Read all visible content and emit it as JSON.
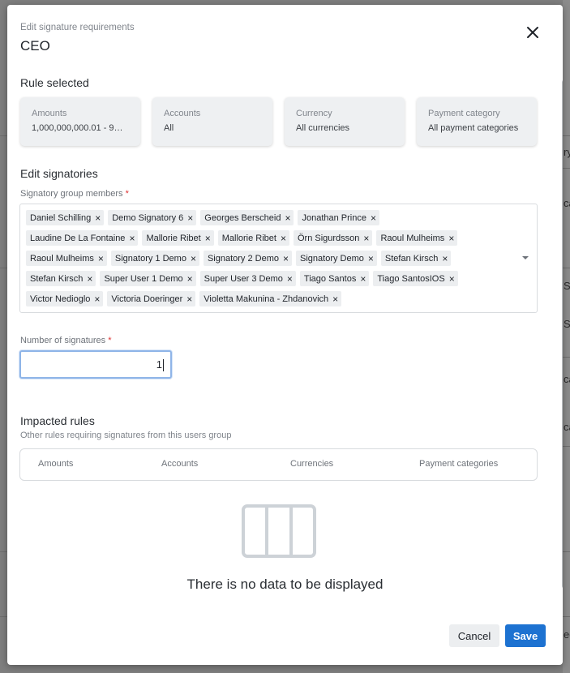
{
  "modal": {
    "caption": "Edit signature requirements",
    "title": "CEO"
  },
  "rule_selected": {
    "title": "Rule selected",
    "cards": [
      {
        "label": "Amounts",
        "value": "1,000,000,000.01 - 9…"
      },
      {
        "label": "Accounts",
        "value": "All"
      },
      {
        "label": "Currency",
        "value": "All currencies"
      },
      {
        "label": "Payment category",
        "value": "All payment categories"
      }
    ]
  },
  "edit_signatories": {
    "title": "Edit signatories",
    "members_label": "Signatory group members",
    "required_mark": "*",
    "members": [
      [
        "Daniel Schilling",
        "Demo Signatory 6",
        "Georges Berscheid",
        "Jonathan Prince"
      ],
      [
        "Laudine De La Fontaine",
        "Mallorie Ribet",
        "Mallorie Ribet",
        "Örn Sigurdsson",
        "Raoul Mulheims"
      ],
      [
        "Raoul Mulheims",
        "Signatory 1 Demo",
        "Signatory 2 Demo",
        "Signatory Demo",
        "Stefan Kirsch"
      ],
      [
        "Stefan Kirsch",
        "Super User 1 Demo",
        "Super User 3 Demo",
        "Tiago Santos",
        "Tiago SantosIOS"
      ],
      [
        "Victor Nedioglo",
        "Victoria Doeringer",
        "Violetta Makunina - Zhdanovich"
      ]
    ],
    "remove_glyph": "×",
    "num_label": "Number of signatures",
    "num_value": "1"
  },
  "impacted_rules": {
    "title": "Impacted rules",
    "subtitle": "Other rules requiring signatures from this users group",
    "columns": [
      "Amounts",
      "Accounts",
      "Currencies",
      "Payment categories"
    ],
    "empty_text": "There is no data to be displayed"
  },
  "footer": {
    "cancel_label": "Cancel",
    "save_label": "Save"
  },
  "background_fragments": [
    "ry",
    "ca",
    "S",
    "S",
    "ca",
    "ca",
    "eg"
  ],
  "colors": {
    "primary": "#1d72d1",
    "chip_bg": "#eceef0",
    "card_bg": "#eef0f2",
    "focus_border": "#8fb5e8",
    "required": "#dd3333"
  }
}
